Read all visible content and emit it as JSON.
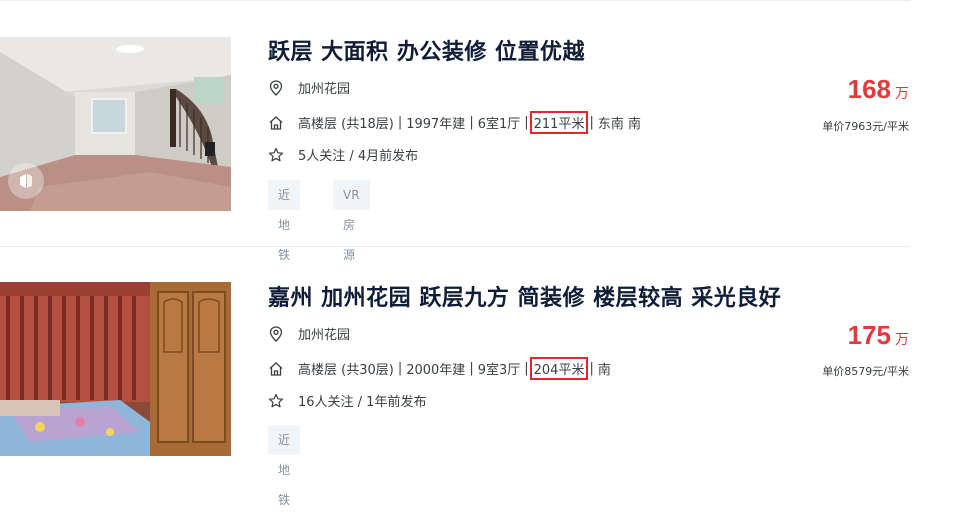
{
  "listings": [
    {
      "title": "跃层 大面积 办公装修 位置优越",
      "community": "加州花园",
      "floor": "高楼层 (共18层)",
      "year": "1997年建",
      "layout": "6室1厅",
      "area": "211平米",
      "orientation": "东南 南",
      "follow": "5人关注 / 4月前发布",
      "tags": [
        "近地铁",
        "VR房源"
      ],
      "price": "168",
      "price_unit": "万",
      "unit_price": "单价7963元/平米"
    },
    {
      "title": "嘉州 加州花园 跃层九方 简装修 楼层较高 采光良好",
      "community": "加州花园",
      "floor": "高楼层 (共30层)",
      "year": "2000年建",
      "layout": "9室3厅",
      "area": "204平米",
      "orientation": "南",
      "follow": "16人关注 / 1年前发布",
      "tags": [
        "近地铁"
      ],
      "price": "175",
      "price_unit": "万",
      "unit_price": "单价8579元/平米"
    }
  ],
  "separator": "|",
  "colors": {
    "title": "#101d37",
    "price": "#e4393c",
    "highlight_box": "#e2262b",
    "tag_bg": "#f2f5f7"
  },
  "icons": [
    "location-pin-icon",
    "house-icon",
    "star-icon",
    "vr-badge-icon"
  ]
}
